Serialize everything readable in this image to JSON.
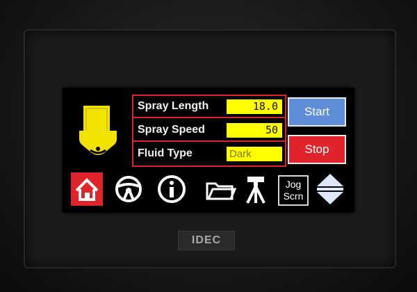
{
  "fields": [
    {
      "label": "Spray Length",
      "value": "18.0"
    },
    {
      "label": "Spray Speed",
      "value": "50"
    },
    {
      "label": "Fluid Type",
      "value": "Dark"
    }
  ],
  "buttons": {
    "start_label": "Start",
    "stop_label": "Stop"
  },
  "nav": {
    "jog_line1": "Jog",
    "jog_line2": "Scrn",
    "icons": [
      "home-icon",
      "steering-wheel-icon",
      "info-icon",
      "folder-icon",
      "tripod-icon",
      "jog-screen-button",
      "up-down-arrows-icon"
    ]
  },
  "brand": {
    "logo": "IDEC"
  },
  "colors": {
    "field_border": "#e0242b",
    "field_value_bg": "#ffff00",
    "start_bg": "#5f8ed6",
    "stop_bg": "#e0242b",
    "home_bg": "#e0242b",
    "robot_icon": "#f2e200"
  }
}
